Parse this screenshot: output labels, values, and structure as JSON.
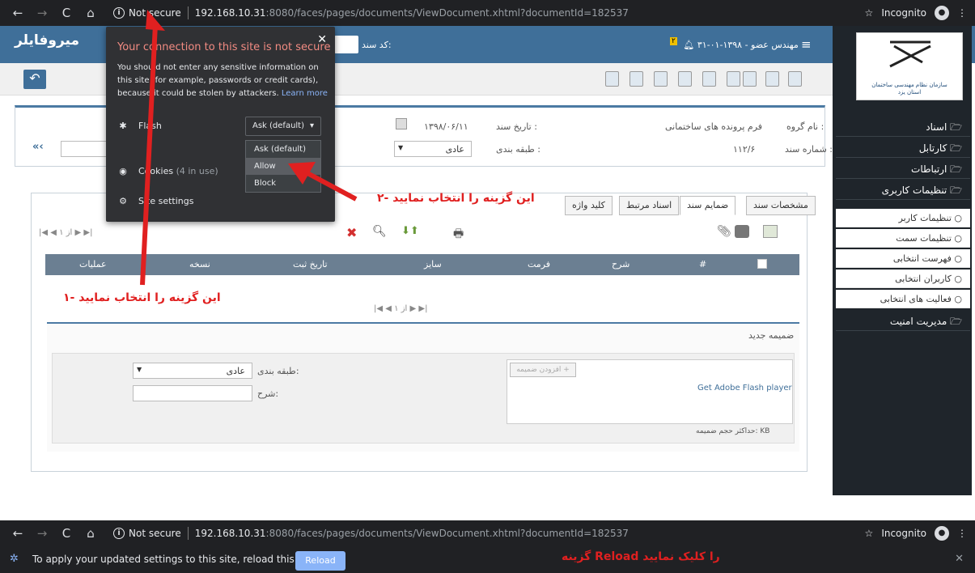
{
  "browser": {
    "not_secure": "Not secure",
    "url_host": "192.168.10.31",
    "url_path": ":8080/faces/pages/documents/ViewDocument.xhtml?documentId=182537",
    "incognito": "Incognito"
  },
  "header": {
    "logo": "میروفایلر",
    "user": "مهندس عضو - ۱۳۹۸-۰۱-۳۱",
    "notif_count": "۲",
    "doc_code_label": "کد سند:"
  },
  "org": {
    "name_line1": "سازمان نظام مهندسی ساختمان",
    "name_line2": "استان یزد"
  },
  "sidebar": {
    "items": [
      {
        "label": "اسناد"
      },
      {
        "label": "کارتابل"
      },
      {
        "label": "ارتباطات"
      },
      {
        "label": "تنظیمات کاربری"
      }
    ],
    "subitems": [
      {
        "label": "تنظیمات کاربر"
      },
      {
        "label": "تنظیمات سمت"
      },
      {
        "label": "فهرست انتخابی"
      },
      {
        "label": "کاربران انتخابی"
      },
      {
        "label": "فعالیت های انتخابی"
      }
    ],
    "security": "مدیریت امنیت"
  },
  "form": {
    "group_label": "نام گروه :",
    "group_value": "فرم پرونده های ساختمانی",
    "docdate_label": "تاریخ سند :",
    "docdate_value": "۱۳۹۸/۰۶/۱۱",
    "docnum_label": "شماره سند :",
    "docnum_value": "۱۱۲/۶",
    "class_label": "طبقه بندی :",
    "class_value": "عادی"
  },
  "tabs": [
    {
      "label": "مشخصات سند"
    },
    {
      "label": "ضمایم سند"
    },
    {
      "label": "اسناد مرتبط"
    },
    {
      "label": "کلید واژه"
    }
  ],
  "pager": {
    "text": "از ۱"
  },
  "table": {
    "columns": [
      "#",
      "شرح",
      "فرمت",
      "سایز",
      "تاریخ ثبت",
      "نسخه",
      "عملیات"
    ]
  },
  "attachment": {
    "title": "ضمیمه جدید",
    "add_button": "افزودن ضمیمه",
    "flash_link": "Get Adobe Flash player",
    "max_size": "حداکثر حجم ضمیمه: KB",
    "class_label": "طبقه بندی:",
    "class_value": "عادی",
    "desc_label": "شرح:"
  },
  "popup": {
    "title": "Your connection to this site is not secure",
    "desc": "You should not enter any sensitive information on this site (for example, passwords or credit cards), because it could be stolen by attackers.",
    "learn_more": "Learn more",
    "flash_label": "Flash",
    "dropdown_value": "Ask (default)",
    "options": [
      "Ask (default)",
      "Allow",
      "Block"
    ],
    "cookies": "Cookies",
    "cookies_count": "(4 in use)",
    "site_settings": "Site settings"
  },
  "annotations": {
    "note1": "۱- این گزینه را انتخاب نمایید",
    "note2": "۲- این گزینه را انتخاب نمایید",
    "note3": "گزینه Reload را کلیک نمایید"
  },
  "infobar": {
    "message": "To apply your updated settings to this site, reload this page",
    "reload": "Reload"
  },
  "colors": {
    "accent": "#3f6f99",
    "annotation": "#e02020",
    "sidebar": "#1f252b"
  }
}
